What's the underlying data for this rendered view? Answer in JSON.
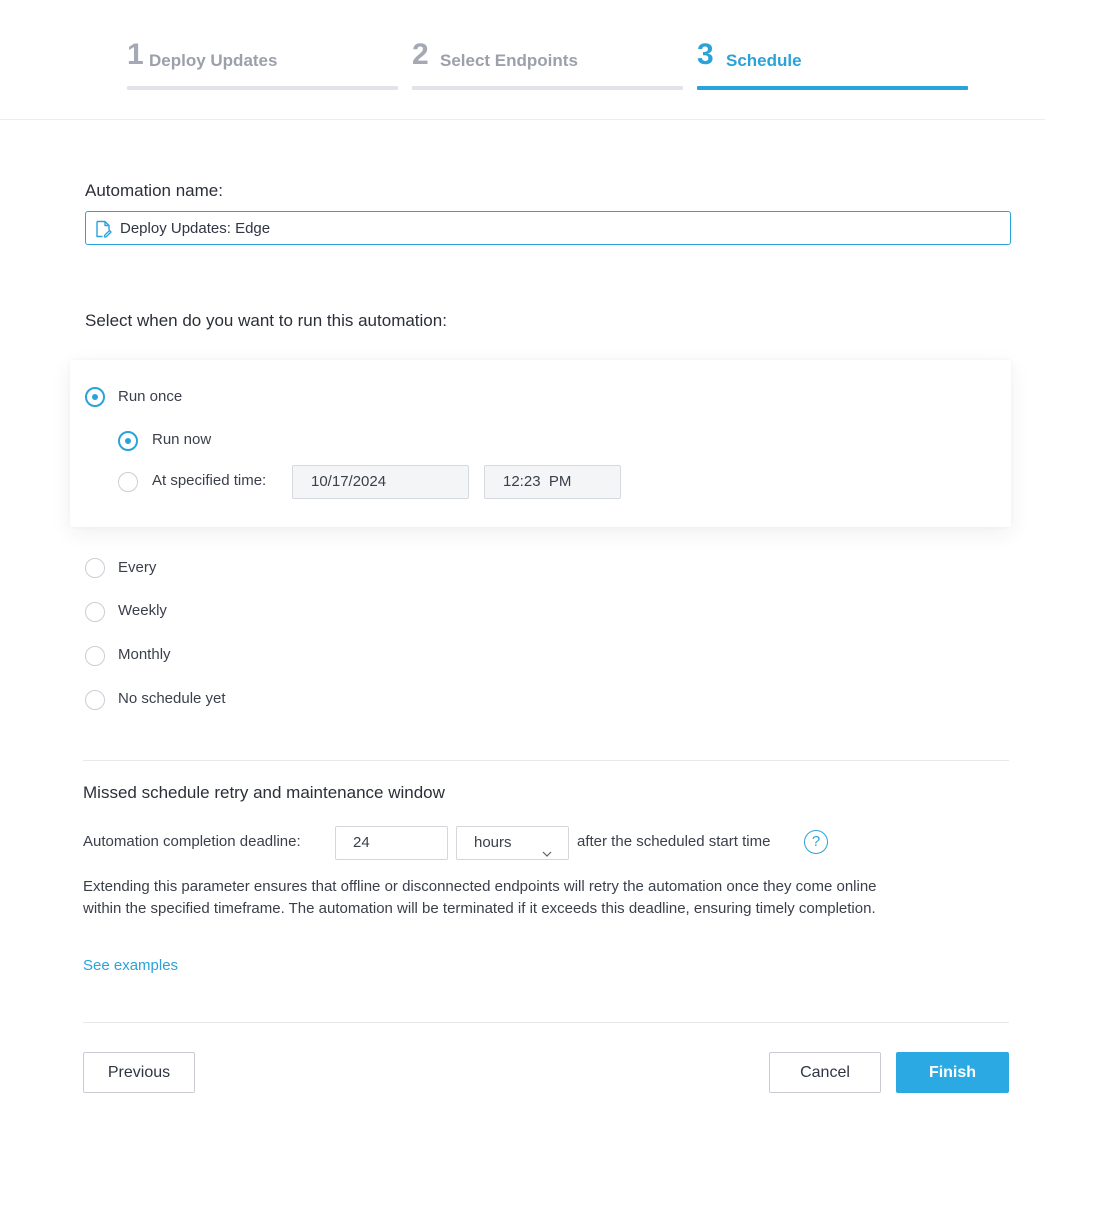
{
  "stepper": {
    "steps": [
      {
        "number": "1",
        "label": "Deploy Updates",
        "active": false
      },
      {
        "number": "2",
        "label": "Select Endpoints",
        "active": false
      },
      {
        "number": "3",
        "label": "Schedule",
        "active": true
      }
    ]
  },
  "automation_name": {
    "label": "Automation name:",
    "value": "Deploy Updates: Edge",
    "icon": "edit-document-icon"
  },
  "schedule": {
    "question": "Select when do you want to run this automation:",
    "run_once": {
      "label": "Run once",
      "selected": true,
      "run_now": {
        "label": "Run now",
        "selected": true
      },
      "at_specified_time": {
        "label": "At specified time:",
        "selected": false,
        "date": "10/17/2024",
        "time": "12:23  PM"
      }
    },
    "options": [
      {
        "label": "Every",
        "selected": false
      },
      {
        "label": "Weekly",
        "selected": false
      },
      {
        "label": "Monthly",
        "selected": false
      },
      {
        "label": "No schedule yet",
        "selected": false
      }
    ]
  },
  "retry": {
    "title": "Missed schedule retry and maintenance window",
    "deadline_label": "Automation completion deadline:",
    "deadline_value": "24",
    "unit_value": "hours",
    "after_label": "after the scheduled start time",
    "help_symbol": "?",
    "description": "Extending this parameter ensures that offline or disconnected endpoints will retry the automation once they come online within the specified timeframe. The automation will be terminated if it exceeds this deadline, ensuring timely completion.",
    "examples_link": "See examples"
  },
  "footer": {
    "previous_label": "Previous",
    "cancel_label": "Cancel",
    "finish_label": "Finish"
  },
  "colors": {
    "accent": "#2aa3d9",
    "finish_button": "#2aa9e3",
    "inactive_step": "#a4a9b3"
  }
}
